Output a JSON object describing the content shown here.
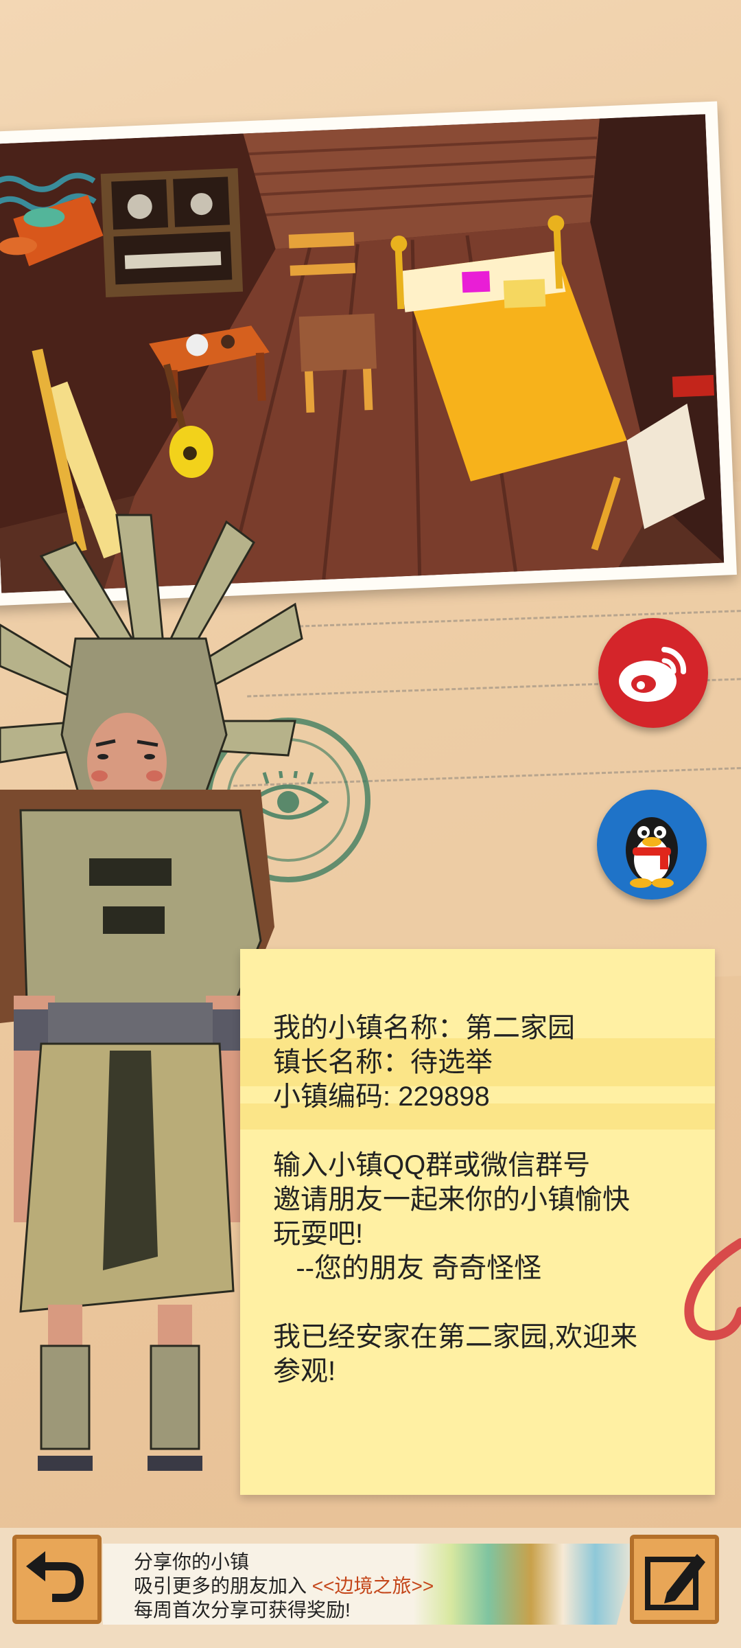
{
  "colors": {
    "background": "#ecc9a0",
    "note": "#fff0a3",
    "weibo": "#d4252a",
    "qq": "#1f73c8",
    "button": "#e8a657",
    "highlight": "#c4461a"
  },
  "social": {
    "weibo_icon": "weibo-icon",
    "qq_icon": "qq-penguin-icon"
  },
  "note": {
    "town_name_line": "我的小镇名称：第二家园",
    "mayor_line": "镇长名称：待选举",
    "code_line": "小镇编码: 229898",
    "invite_line1": "输入小镇QQ群或微信群号",
    "invite_line2": "邀请朋友一起来你的小镇愉快",
    "invite_line3": "玩耍吧!",
    "signature": "   --您的朋友 奇奇怪怪",
    "settled_line1": "我已经安家在第二家园,欢迎来",
    "settled_line2": "参观!"
  },
  "bottom": {
    "line1": "分享你的小镇",
    "line2_prefix": "吸引更多的朋友加入 ",
    "line2_highlight": "<<边境之旅>>",
    "line3": "每周首次分享可获得奖励!",
    "back_icon": "back-arrow-icon",
    "edit_icon": "edit-pencil-icon"
  }
}
